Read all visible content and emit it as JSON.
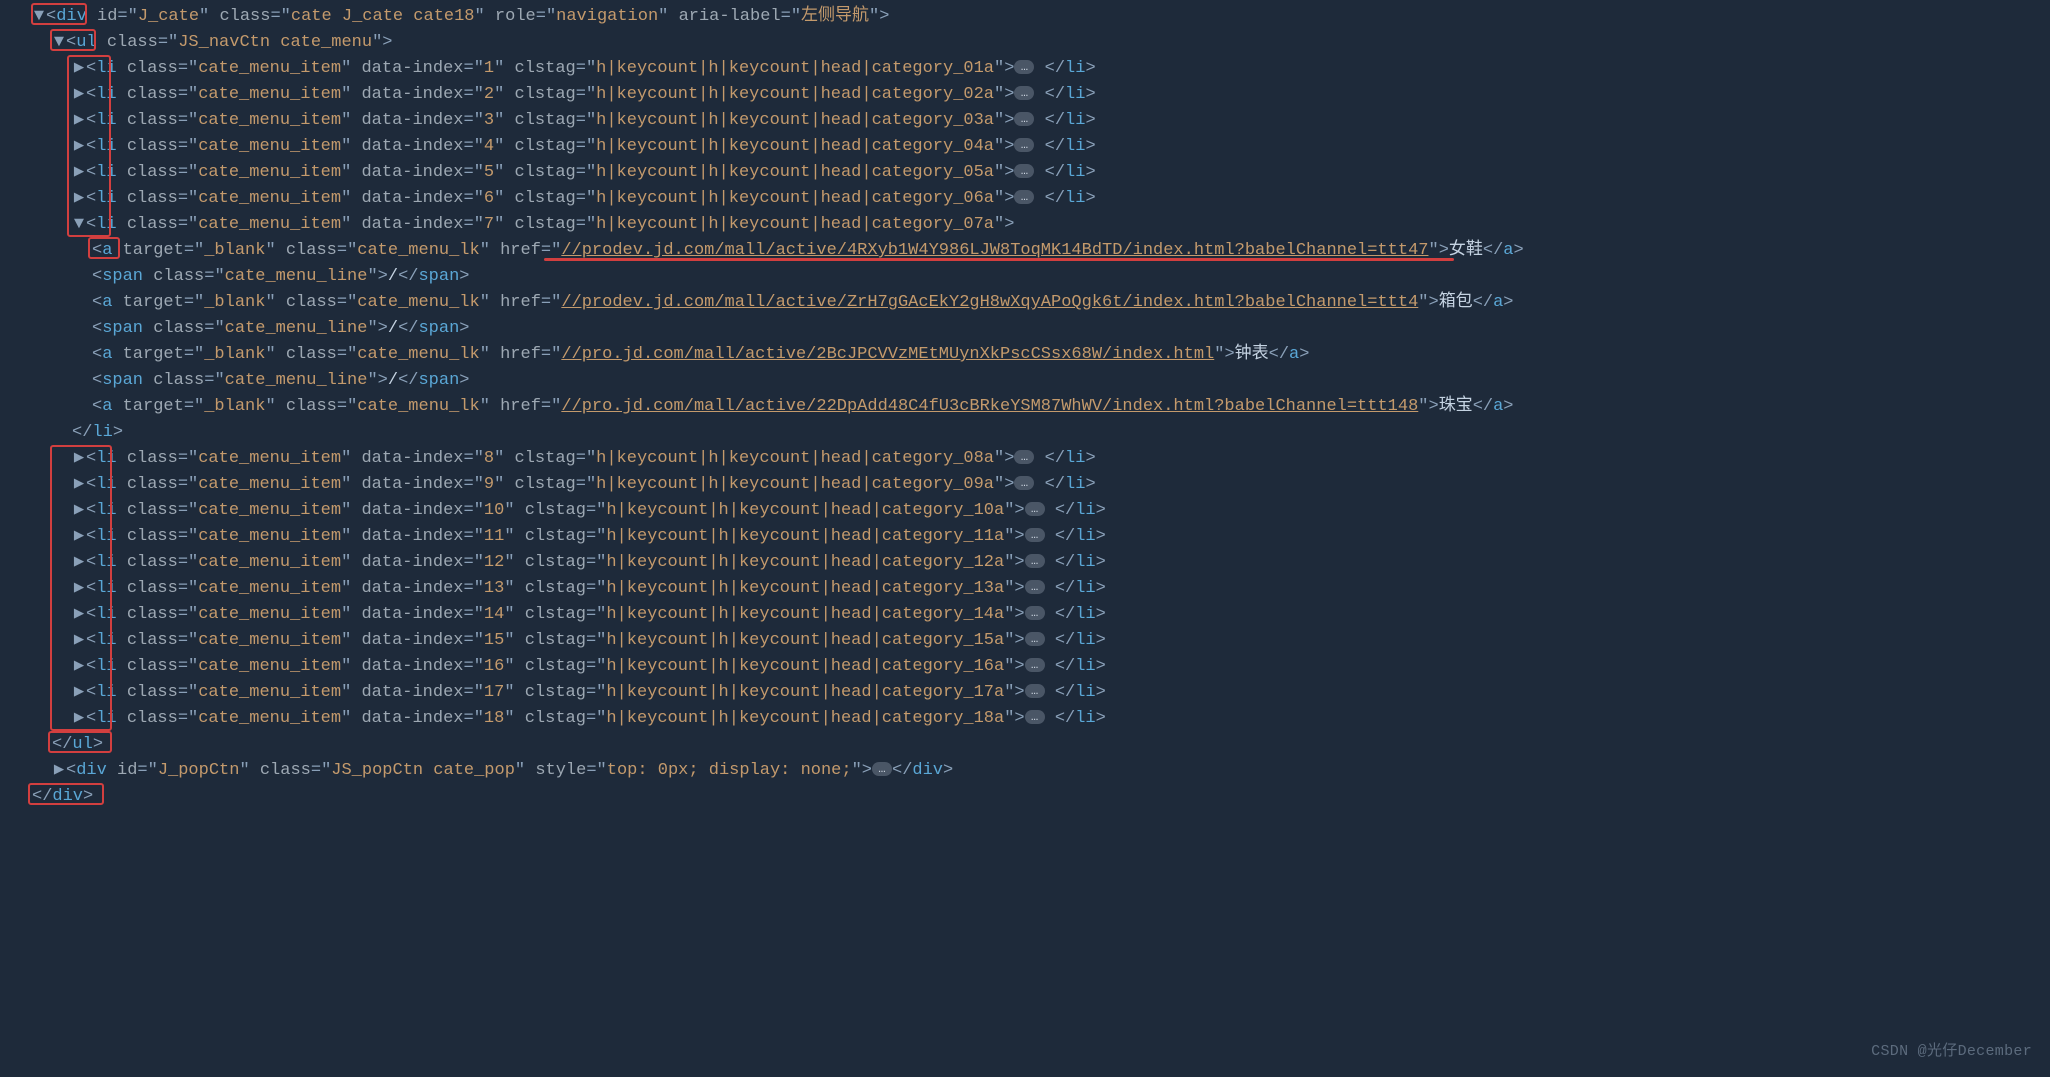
{
  "tags": {
    "div": "div",
    "ul": "ul",
    "li": "li",
    "a": "a",
    "span": "span"
  },
  "attrnames": {
    "id": "id",
    "class": "class",
    "role": "role",
    "ariaLabel": "aria-label",
    "dataIndex": "data-index",
    "clstag": "clstag",
    "target": "target",
    "href": "href",
    "style": "style"
  },
  "topDiv": {
    "id": "J_cate",
    "class": "cate J_cate cate18",
    "role": "navigation",
    "ariaLabel": "左侧导航"
  },
  "ul": {
    "class": "JS_navCtn cate_menu"
  },
  "liCommon": {
    "class": "cate_menu_item"
  },
  "liClstagPrefix": "h|keycount|h|keycount|head|category_",
  "liClstagSuffix": "a",
  "liCount": 18,
  "expandedIndex": 7,
  "links": [
    {
      "text": "女鞋",
      "href": "//prodev.jd.com/mall/active/4RXyb1W4Y986LJW8ToqMK14BdTD/index.html?babelChannel=ttt47"
    },
    {
      "text": "箱包",
      "href": "//prodev.jd.com/mall/active/ZrH7gGAcEkY2gH8wXqyAPoQgk6t/index.html?babelChannel=ttt4"
    },
    {
      "text": "钟表",
      "href": "//pro.jd.com/mall/active/2BcJPCVVzMEtMUynXkPscCSsx68W/index.html"
    },
    {
      "text": "珠宝",
      "href": "//pro.jd.com/mall/active/22DpAdd48C4fU3cBRkeYSM87WhWV/index.html?babelChannel=ttt148"
    }
  ],
  "aCommon": {
    "target": "_blank",
    "class": "cate_menu_lk"
  },
  "spanLine": {
    "class": "cate_menu_line",
    "text": "/"
  },
  "popDiv": {
    "id": "J_popCtn",
    "class": "JS_popCtn cate_pop",
    "style": "top: 0px; display: none;"
  },
  "watermark": "CSDN @光仔December",
  "carets": {
    "down": "▼",
    "right": "▶"
  },
  "ellipsis": "…"
}
